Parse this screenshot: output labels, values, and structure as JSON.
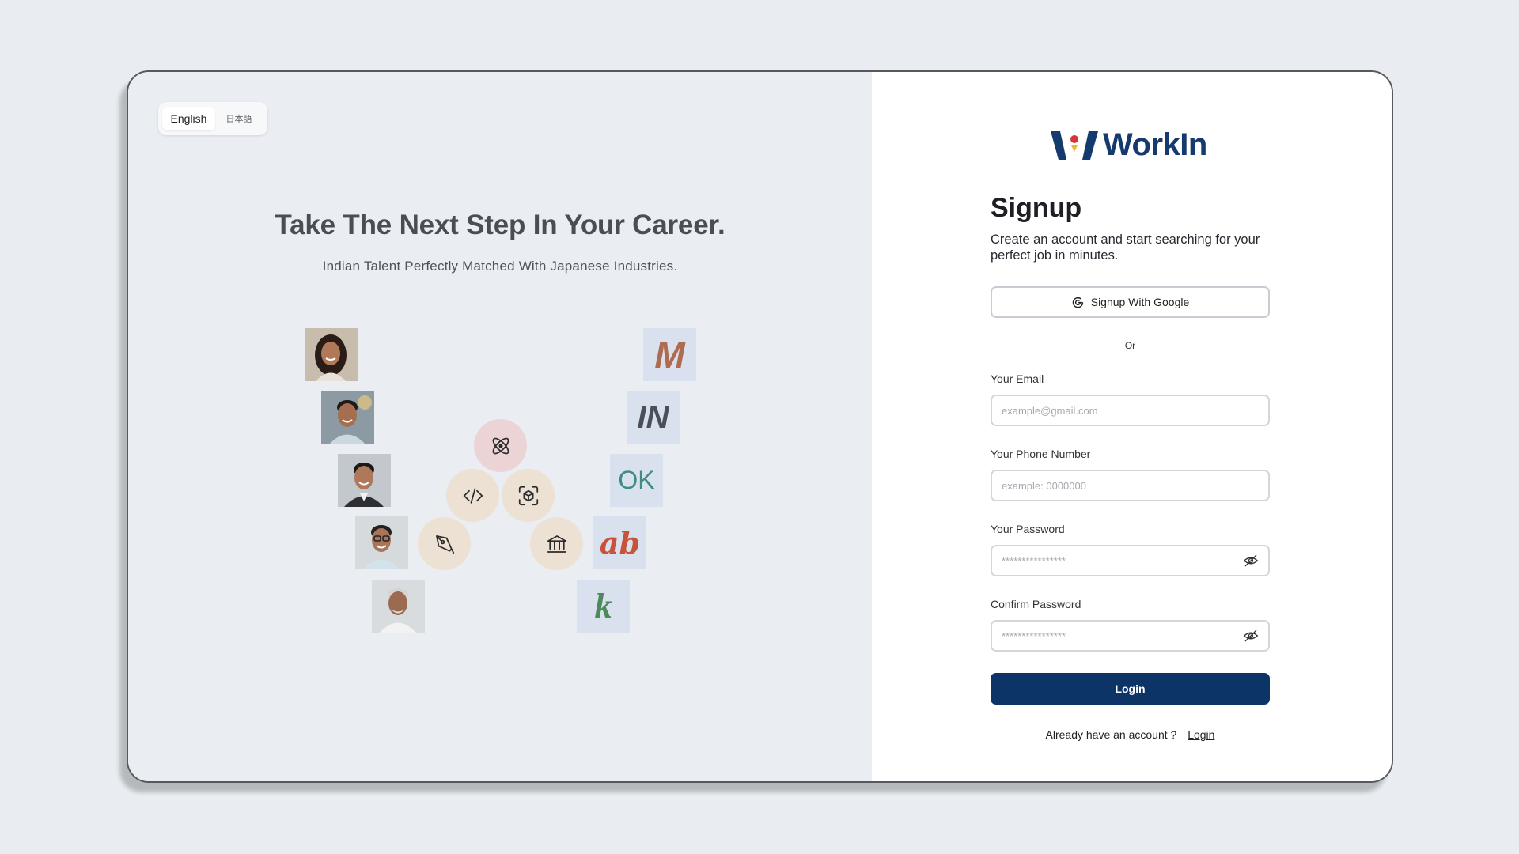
{
  "language": {
    "english": "English",
    "japanese": "日本語",
    "selected": "English"
  },
  "hero": {
    "headline": "Take The Next Step In Your Career.",
    "subline": "Indian Talent Perfectly Matched With Japanese Industries."
  },
  "tiles": [
    "M",
    "IN",
    "OK",
    "ab",
    "k"
  ],
  "colors": {
    "primary": "#0d3466",
    "brand_text": "#143a6e",
    "tile_bg": "#d9e1ee",
    "circle_pink": "#ecd4d6",
    "circle_beige": "#ece1d3"
  },
  "brand": {
    "name": "WorkIn"
  },
  "signup": {
    "title": "Signup",
    "description": "Create an account and start searching for your perfect job in minutes.",
    "google_button": "Signup With Google",
    "or": "Or",
    "email_label": "Your Email",
    "email_placeholder": "example@gmail.com",
    "phone_label": "Your Phone Number",
    "phone_placeholder": "example: 0000000",
    "password_label": "Your Password",
    "password_value": "****************",
    "confirm_label": "Confirm Password",
    "confirm_value": "****************",
    "submit_button": "Login",
    "already_text": "Already have an account ?",
    "login_link": "Login"
  }
}
